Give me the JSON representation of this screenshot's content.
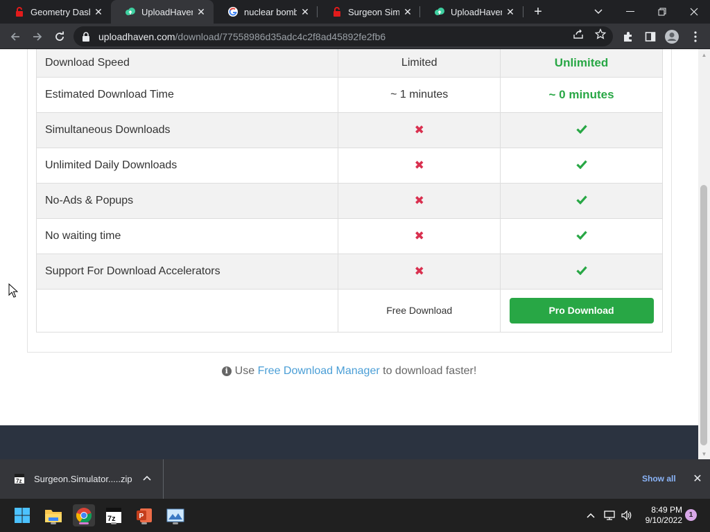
{
  "browser": {
    "tabs": [
      {
        "title": "Geometry Dash",
        "icon": "lock-red-icon"
      },
      {
        "title": "UploadHaven -",
        "icon": "cloud-icon",
        "active": true
      },
      {
        "title": "nuclear bomb -",
        "icon": "google-icon"
      },
      {
        "title": "Surgeon Simula",
        "icon": "lock-red-icon"
      },
      {
        "title": "UploadHaven -",
        "icon": "cloud-icon"
      }
    ],
    "url_host": "uploadhaven.com",
    "url_path": "/download/77558986d35adc4c2f8ad45892fe2fb6"
  },
  "comparison": {
    "rows": [
      {
        "feature": "Download Speed",
        "free": "Limited",
        "pro": "Unlimited",
        "type": "text"
      },
      {
        "feature": "Estimated Download Time",
        "free": "~ 1 minutes",
        "pro": "~ 0 minutes",
        "type": "text"
      },
      {
        "feature": "Simultaneous Downloads",
        "free": "✖",
        "pro": "check",
        "type": "mark"
      },
      {
        "feature": "Unlimited Daily Downloads",
        "free": "✖",
        "pro": "check",
        "type": "mark"
      },
      {
        "feature": "No-Ads & Popups",
        "free": "✖",
        "pro": "check",
        "type": "mark"
      },
      {
        "feature": "No waiting time",
        "free": "✖",
        "pro": "check",
        "type": "mark"
      },
      {
        "feature": "Support For Download Accelerators",
        "free": "✖",
        "pro": "check",
        "type": "mark"
      }
    ],
    "free_download_label": "Free Download",
    "pro_download_label": "Pro Download"
  },
  "tip": {
    "prefix": "Use",
    "link": "Free Download Manager",
    "suffix": "to download faster!"
  },
  "download_bar": {
    "filename": "Surgeon.Simulator.....zip",
    "show_all": "Show all"
  },
  "taskbar": {
    "apps": [
      "windows-start-icon",
      "file-explorer-icon",
      "chrome-icon",
      "7zip-icon",
      "powerpoint-icon",
      "photo-app-icon"
    ],
    "time": "8:49 PM",
    "date": "9/10/2022",
    "notifications": "1"
  },
  "colors": {
    "accent_green": "#28a745",
    "cross_red": "#d9304f",
    "link_blue": "#4a9ed6",
    "footer_dark": "#2b3340"
  }
}
